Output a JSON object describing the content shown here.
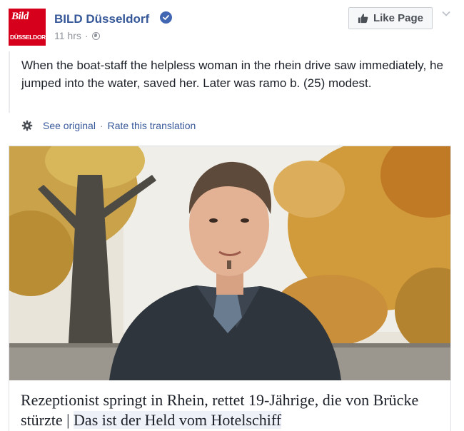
{
  "page": {
    "name": "BILD Düsseldorf",
    "avatar_text_top": "Bild",
    "avatar_text_bottom": "DÜSSELDORF",
    "timestamp": "11 hrs",
    "accent_color": "#365899",
    "brand_color": "#d6001c"
  },
  "actions": {
    "like_page_label": "Like Page",
    "like_icon": "thumbs-up-icon",
    "menu_icon": "chevron-down-icon"
  },
  "post": {
    "text": "When the boat-staff the helpless woman in the rhein drive saw immediately, he jumped into the water, saved her. Later was ramo b. (25) modest.",
    "see_original": "See original",
    "separator": "·",
    "rate_translation": "Rate this translation"
  },
  "attachment": {
    "headline_part1": "Rezeptionist springt in Rhein, rettet 19-Jährige, die von Brücke stürzte |",
    "headline_part2": "Das ist der Held vom Hotelschiff"
  }
}
